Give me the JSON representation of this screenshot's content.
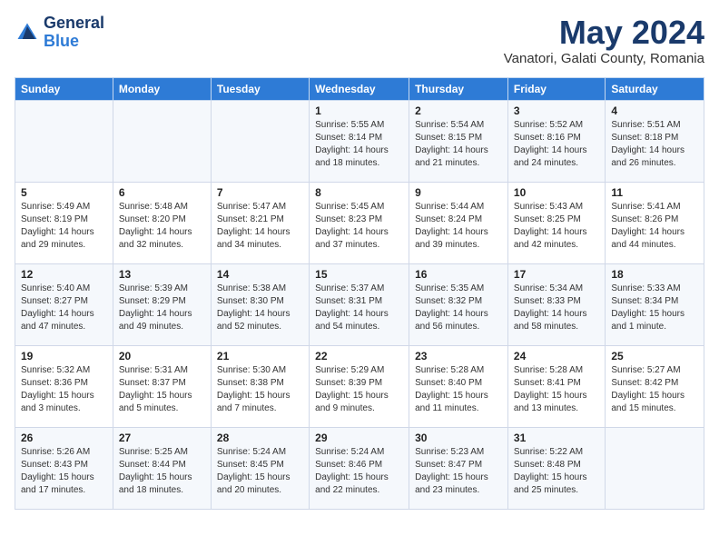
{
  "header": {
    "logo_general": "General",
    "logo_blue": "Blue",
    "month_title": "May 2024",
    "location": "Vanatori, Galati County, Romania"
  },
  "days_of_week": [
    "Sunday",
    "Monday",
    "Tuesday",
    "Wednesday",
    "Thursday",
    "Friday",
    "Saturday"
  ],
  "weeks": [
    [
      {
        "day": "",
        "info": ""
      },
      {
        "day": "",
        "info": ""
      },
      {
        "day": "",
        "info": ""
      },
      {
        "day": "1",
        "info": "Sunrise: 5:55 AM\nSunset: 8:14 PM\nDaylight: 14 hours\nand 18 minutes."
      },
      {
        "day": "2",
        "info": "Sunrise: 5:54 AM\nSunset: 8:15 PM\nDaylight: 14 hours\nand 21 minutes."
      },
      {
        "day": "3",
        "info": "Sunrise: 5:52 AM\nSunset: 8:16 PM\nDaylight: 14 hours\nand 24 minutes."
      },
      {
        "day": "4",
        "info": "Sunrise: 5:51 AM\nSunset: 8:18 PM\nDaylight: 14 hours\nand 26 minutes."
      }
    ],
    [
      {
        "day": "5",
        "info": "Sunrise: 5:49 AM\nSunset: 8:19 PM\nDaylight: 14 hours\nand 29 minutes."
      },
      {
        "day": "6",
        "info": "Sunrise: 5:48 AM\nSunset: 8:20 PM\nDaylight: 14 hours\nand 32 minutes."
      },
      {
        "day": "7",
        "info": "Sunrise: 5:47 AM\nSunset: 8:21 PM\nDaylight: 14 hours\nand 34 minutes."
      },
      {
        "day": "8",
        "info": "Sunrise: 5:45 AM\nSunset: 8:23 PM\nDaylight: 14 hours\nand 37 minutes."
      },
      {
        "day": "9",
        "info": "Sunrise: 5:44 AM\nSunset: 8:24 PM\nDaylight: 14 hours\nand 39 minutes."
      },
      {
        "day": "10",
        "info": "Sunrise: 5:43 AM\nSunset: 8:25 PM\nDaylight: 14 hours\nand 42 minutes."
      },
      {
        "day": "11",
        "info": "Sunrise: 5:41 AM\nSunset: 8:26 PM\nDaylight: 14 hours\nand 44 minutes."
      }
    ],
    [
      {
        "day": "12",
        "info": "Sunrise: 5:40 AM\nSunset: 8:27 PM\nDaylight: 14 hours\nand 47 minutes."
      },
      {
        "day": "13",
        "info": "Sunrise: 5:39 AM\nSunset: 8:29 PM\nDaylight: 14 hours\nand 49 minutes."
      },
      {
        "day": "14",
        "info": "Sunrise: 5:38 AM\nSunset: 8:30 PM\nDaylight: 14 hours\nand 52 minutes."
      },
      {
        "day": "15",
        "info": "Sunrise: 5:37 AM\nSunset: 8:31 PM\nDaylight: 14 hours\nand 54 minutes."
      },
      {
        "day": "16",
        "info": "Sunrise: 5:35 AM\nSunset: 8:32 PM\nDaylight: 14 hours\nand 56 minutes."
      },
      {
        "day": "17",
        "info": "Sunrise: 5:34 AM\nSunset: 8:33 PM\nDaylight: 14 hours\nand 58 minutes."
      },
      {
        "day": "18",
        "info": "Sunrise: 5:33 AM\nSunset: 8:34 PM\nDaylight: 15 hours\nand 1 minute."
      }
    ],
    [
      {
        "day": "19",
        "info": "Sunrise: 5:32 AM\nSunset: 8:36 PM\nDaylight: 15 hours\nand 3 minutes."
      },
      {
        "day": "20",
        "info": "Sunrise: 5:31 AM\nSunset: 8:37 PM\nDaylight: 15 hours\nand 5 minutes."
      },
      {
        "day": "21",
        "info": "Sunrise: 5:30 AM\nSunset: 8:38 PM\nDaylight: 15 hours\nand 7 minutes."
      },
      {
        "day": "22",
        "info": "Sunrise: 5:29 AM\nSunset: 8:39 PM\nDaylight: 15 hours\nand 9 minutes."
      },
      {
        "day": "23",
        "info": "Sunrise: 5:28 AM\nSunset: 8:40 PM\nDaylight: 15 hours\nand 11 minutes."
      },
      {
        "day": "24",
        "info": "Sunrise: 5:28 AM\nSunset: 8:41 PM\nDaylight: 15 hours\nand 13 minutes."
      },
      {
        "day": "25",
        "info": "Sunrise: 5:27 AM\nSunset: 8:42 PM\nDaylight: 15 hours\nand 15 minutes."
      }
    ],
    [
      {
        "day": "26",
        "info": "Sunrise: 5:26 AM\nSunset: 8:43 PM\nDaylight: 15 hours\nand 17 minutes."
      },
      {
        "day": "27",
        "info": "Sunrise: 5:25 AM\nSunset: 8:44 PM\nDaylight: 15 hours\nand 18 minutes."
      },
      {
        "day": "28",
        "info": "Sunrise: 5:24 AM\nSunset: 8:45 PM\nDaylight: 15 hours\nand 20 minutes."
      },
      {
        "day": "29",
        "info": "Sunrise: 5:24 AM\nSunset: 8:46 PM\nDaylight: 15 hours\nand 22 minutes."
      },
      {
        "day": "30",
        "info": "Sunrise: 5:23 AM\nSunset: 8:47 PM\nDaylight: 15 hours\nand 23 minutes."
      },
      {
        "day": "31",
        "info": "Sunrise: 5:22 AM\nSunset: 8:48 PM\nDaylight: 15 hours\nand 25 minutes."
      },
      {
        "day": "",
        "info": ""
      }
    ]
  ]
}
